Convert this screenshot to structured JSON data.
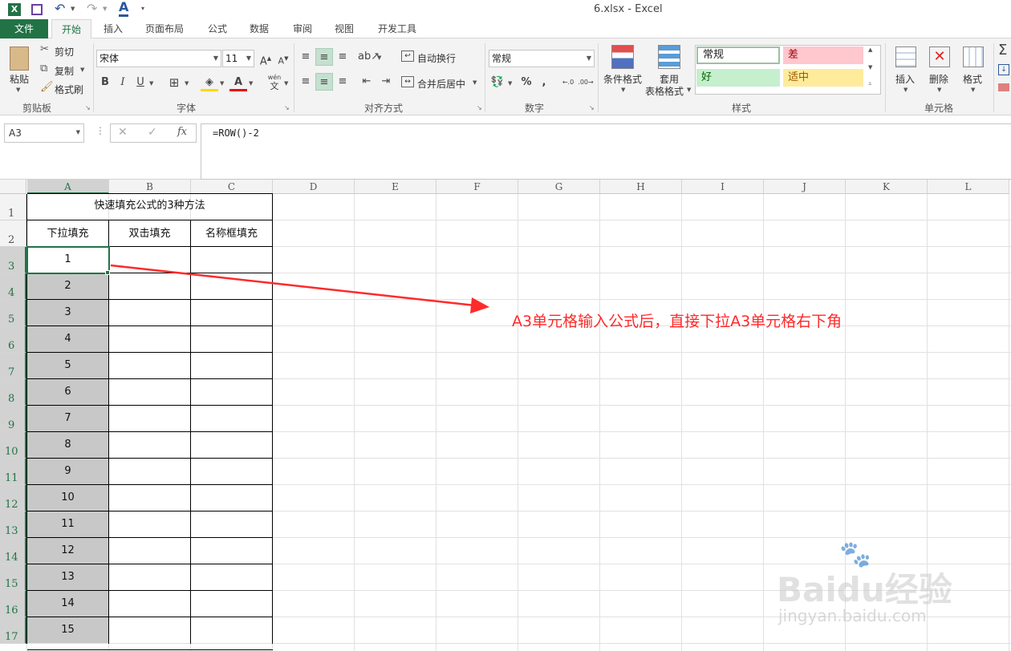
{
  "window": {
    "title": "6.xlsx - Excel"
  },
  "quick_access": {
    "save_icon": "save-icon",
    "undo_icon": "undo-icon",
    "redo_icon": "redo-icon",
    "font_color_icon": "font-color-icon"
  },
  "tabs": [
    {
      "label": "文件"
    },
    {
      "label": "开始"
    },
    {
      "label": "插入"
    },
    {
      "label": "页面布局"
    },
    {
      "label": "公式"
    },
    {
      "label": "数据"
    },
    {
      "label": "审阅"
    },
    {
      "label": "视图"
    },
    {
      "label": "开发工具"
    }
  ],
  "ribbon": {
    "clipboard": {
      "paste": "粘贴",
      "cut": "剪切",
      "copy": "复制",
      "format_painter": "格式刷",
      "label": "剪贴板"
    },
    "font": {
      "name": "宋体",
      "size": "11",
      "label": "字体",
      "wen": "wén",
      "wen_char": "文"
    },
    "align": {
      "wrap": "自动换行",
      "merge": "合并后居中",
      "label": "对齐方式"
    },
    "number": {
      "format": "常规",
      "percent": "%",
      "comma": ",",
      "label": "数字"
    },
    "styles": {
      "conditional": "条件格式",
      "table_line1": "套用",
      "table_line2": "表格格式",
      "normal": "常规",
      "bad": "差",
      "good": "好",
      "neutral": "适中",
      "label": "样式"
    },
    "cells": {
      "insert": "插入",
      "delete": "删除",
      "format": "格式",
      "label": "单元格"
    }
  },
  "formula_bar": {
    "name_box": "A3",
    "fx": "fx",
    "formula": "=ROW()-2"
  },
  "columns": [
    "A",
    "B",
    "C",
    "D",
    "E",
    "F",
    "G",
    "H",
    "I",
    "J",
    "K",
    "L"
  ],
  "rows": [
    "1",
    "2",
    "3",
    "4",
    "5",
    "6",
    "7",
    "8",
    "9",
    "10",
    "11",
    "12",
    "13",
    "14",
    "15",
    "16",
    "17"
  ],
  "table": {
    "title": "快速填充公式的3种方法",
    "headers": [
      "下拉填充",
      "双击填充",
      "名称框填充"
    ],
    "values": [
      "1",
      "2",
      "3",
      "4",
      "5",
      "6",
      "7",
      "8",
      "9",
      "10",
      "11",
      "12",
      "13",
      "14",
      "15"
    ]
  },
  "annotation": {
    "text": "A3单元格输入公式后，直接下拉A3单元格右下角",
    "color": "#ff2a2a"
  },
  "watermark": {
    "brand": "Baidu经验",
    "url": "jingyan.baidu.com"
  },
  "colors": {
    "excel_green": "#217346",
    "bad_fill": "#ffc7ce",
    "good_fill": "#c6efce",
    "neutral_fill": "#ffeb9c"
  }
}
